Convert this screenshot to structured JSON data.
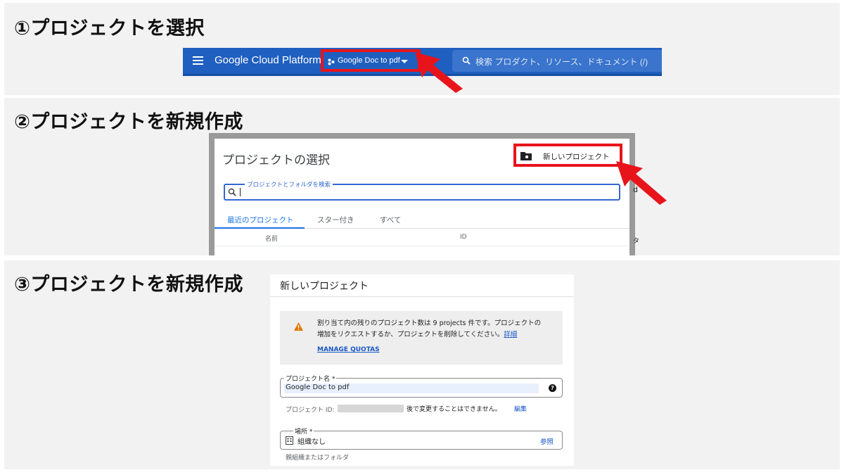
{
  "step1": {
    "heading": "①プロジェクトを選択",
    "topbar": {
      "platform_title": "Google Cloud Platform",
      "project_selector_label": "Google Doc to pdf",
      "search_text": "検索  プロダクト、リソース、ドキュメント (/)",
      "bar_color": "#1f5fbf"
    }
  },
  "step2": {
    "heading": "②プロジェクトを新規作成",
    "dialog": {
      "title": "プロジェクトの選択",
      "new_project_button": "新しいプロジェクト",
      "search_label": "プロジェクトとフォルダを検索",
      "tabs": [
        {
          "label": "最近のプロジェクト",
          "active": true
        },
        {
          "label": "スター付き",
          "active": false
        },
        {
          "label": "すべて",
          "active": false
        }
      ],
      "columns": [
        "名前",
        "ID"
      ],
      "edge_glyphs": [
        "d",
        "タ"
      ]
    }
  },
  "step3": {
    "heading": "③プロジェクトを新規作成",
    "dialog": {
      "title": "新しいプロジェクト",
      "quota": {
        "line1": "割り当て内の残りのプロジェクト数は 9 projects 件です。プロジェクトの",
        "line2": "増加をリクエストするか、プロジェクトを削除してください。",
        "details_link": "詳細",
        "manage_quotas": "MANAGE QUOTAS"
      },
      "project_name": {
        "label": "プロジェクト名 *",
        "value": "Google Doc to pdf",
        "help": "?"
      },
      "project_id": {
        "label": "プロジェクト ID:",
        "note": "後で変更することはできません。",
        "edit_link": "編集"
      },
      "location": {
        "label": "場所 *",
        "value": "組織なし",
        "browse_link": "参照",
        "hint": "親組織またはフォルダ"
      }
    }
  },
  "colors": {
    "highlight_red": "#e8141b",
    "link_blue": "#1a56c4",
    "accent_blue": "#1a73e8"
  }
}
